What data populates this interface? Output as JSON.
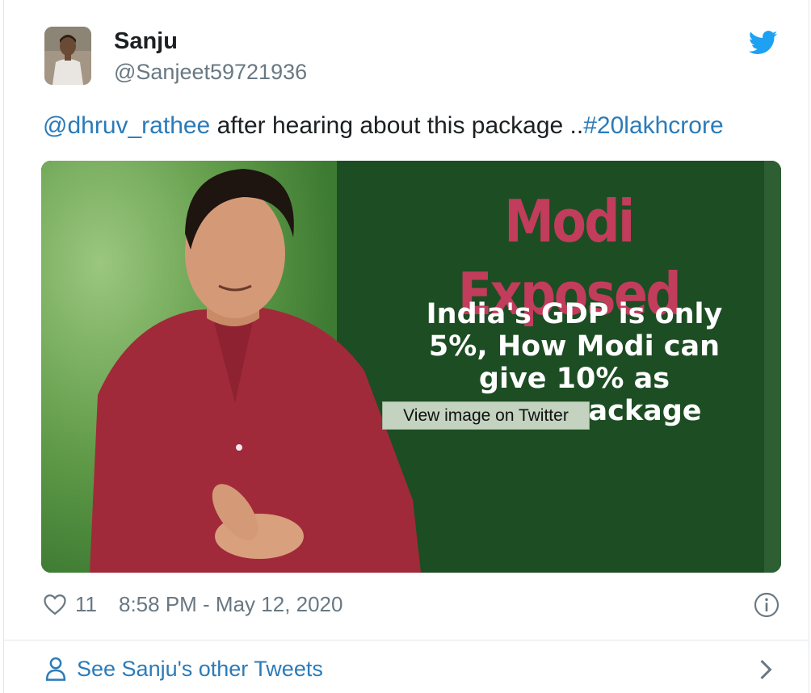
{
  "author": {
    "display_name": "Sanju",
    "screen_name": "@Sanjeet59721936",
    "avatar_icon": "avatar-photo"
  },
  "tweet": {
    "mention": "@dhruv_rathee",
    "text": " after hearing about this package ..",
    "hashtag": "#20lakhcrore"
  },
  "media": {
    "overlay_title": "Modi Exposed",
    "overlay_line1": "India's GDP is only",
    "overlay_line2": "5%, How Modi can",
    "overlay_line3": "give 10% as",
    "overlay_line4": "package",
    "tooltip": "View image on Twitter"
  },
  "footer": {
    "like_count": "11",
    "timestamp": "8:58 PM - May 12, 2020"
  },
  "more": {
    "label": "See Sanju's other Tweets"
  },
  "colors": {
    "link": "#2b7bb9",
    "brand": "#1da1f2",
    "muted": "#697882",
    "title_red": "#c23c5c",
    "board_green": "#1d4d23"
  }
}
